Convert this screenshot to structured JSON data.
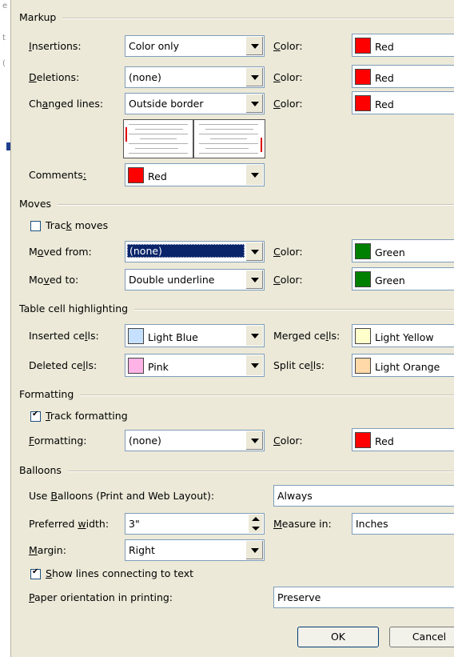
{
  "left_strip": {
    "glyphs": [
      "e",
      "t",
      "("
    ]
  },
  "markup": {
    "section": "Markup",
    "insertions": {
      "prefix": "",
      "u": "I",
      "rest": "nsertions:",
      "value": "Color only"
    },
    "deletions": {
      "prefix": "",
      "u": "D",
      "rest": "eletions:",
      "value": "(none)"
    },
    "changed_lines": {
      "prefix": "Ch",
      "u": "a",
      "rest": "nged lines:",
      "value": "Outside border"
    },
    "color_label": {
      "prefix": "",
      "u": "C",
      "rest": "olor:"
    },
    "ins_color": {
      "name": "Red",
      "swatch": "#ff0000"
    },
    "del_color": {
      "name": "Red",
      "swatch": "#ff0000"
    },
    "chg_color": {
      "name": "Red",
      "swatch": "#ff0000"
    },
    "comments": {
      "prefix": "Comments",
      "u": ":",
      "rest": "",
      "color": "Red",
      "swatch": "#ff0000"
    }
  },
  "moves": {
    "section": "Moves",
    "track": {
      "prefix": "Trac",
      "u": "k",
      "rest": " moves",
      "checked": false
    },
    "moved_from": {
      "prefix": "M",
      "u": "o",
      "rest": "ved from:",
      "value": "(none)",
      "color": "Green",
      "swatch": "#008000"
    },
    "moved_to": {
      "prefix": "Mo",
      "u": "v",
      "rest": "ed to:",
      "value": "Double underline",
      "color": "Green",
      "swatch": "#008000"
    }
  },
  "table": {
    "section": "Table cell highlighting",
    "inserted": {
      "prefix": "Inserted ce",
      "u": "l",
      "rest": "ls:",
      "color": "Light Blue",
      "swatch": "#c6e0ff"
    },
    "deleted": {
      "prefix": "Deleted ce",
      "u": "l",
      "rest": "ls:",
      "color": "Pink",
      "swatch": "#ffb3e6"
    },
    "merged": {
      "prefix": "Merged ce",
      "u": "l",
      "rest": "ls:",
      "color": "Light Yellow",
      "swatch": "#ffffcc"
    },
    "split": {
      "prefix": "Split ce",
      "u": "l",
      "rest": "ls:",
      "color": "Light Orange",
      "swatch": "#ffd9a8"
    }
  },
  "formatting": {
    "section": "Formatting",
    "track": {
      "prefix": "",
      "u": "T",
      "rest": "rack formatting",
      "checked": true
    },
    "formatting": {
      "prefix": "",
      "u": "F",
      "rest": "ormatting:",
      "value": "(none)",
      "color": "Red",
      "swatch": "#ff0000"
    }
  },
  "balloons": {
    "section": "Balloons",
    "use": {
      "prefix": "Use ",
      "u": "B",
      "rest": "alloons (Print and Web Layout):",
      "value": "Always"
    },
    "width": {
      "prefix": "Preferred ",
      "u": "w",
      "rest": "idth:",
      "value": "3\""
    },
    "measure": {
      "prefix": "",
      "u": "M",
      "rest": "easure in:",
      "value": "Inches"
    },
    "margin": {
      "prefix": "",
      "u": "M",
      "rest": "argin:",
      "value": "Right"
    },
    "lines": {
      "prefix": "",
      "u": "S",
      "rest": "how lines connecting to text",
      "checked": true
    },
    "paper": {
      "prefix": "",
      "u": "P",
      "rest": "aper orientation in printing:",
      "value": "Preserve"
    }
  },
  "buttons": {
    "ok": "OK",
    "cancel": "Cancel"
  },
  "colors": {
    "face": "#ece9d8",
    "border": "#7f9db9",
    "selection": "#0a246a"
  }
}
